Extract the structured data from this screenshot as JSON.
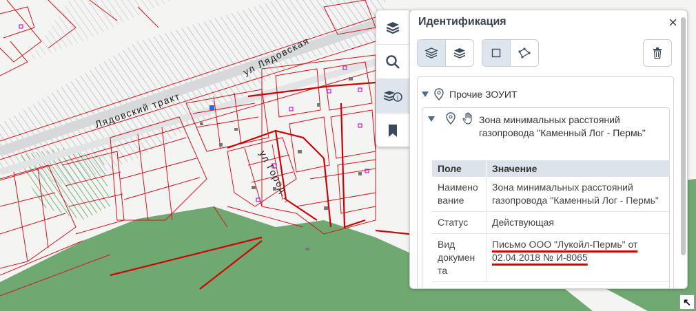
{
  "map": {
    "street_labels": [
      "Лядовский тракт",
      "ул Лядовская",
      "ул Город..."
    ],
    "colors": {
      "background": "#f4f4f2",
      "hatch": "#9ea6b5",
      "parcel": "#d3131b",
      "forest": "#70a872",
      "road": "#d6d8d9"
    }
  },
  "toolbar": {
    "tools": [
      {
        "name": "layers-icon",
        "active": false
      },
      {
        "name": "search-icon",
        "active": false
      },
      {
        "name": "identify-icon",
        "active": true
      },
      {
        "name": "bookmark-icon",
        "active": false
      }
    ]
  },
  "panel": {
    "title": "Идентификация",
    "group": {
      "label": "Прочие ЗОУИТ",
      "item": {
        "title": "Зона минимальных расстояний газопровода \"Каменный Лог - Пермь\"",
        "table": {
          "headers": [
            "Поле",
            "Значение"
          ],
          "rows": [
            {
              "field": "Наимено вание",
              "value": "Зона минимальных расстояний газопровода \"Каменный Лог - Пермь\""
            },
            {
              "field": "Статус",
              "value": "Действующая"
            },
            {
              "field": "Вид докумен та",
              "value_line1": "Письмо ООО \"Лукойл-Пермь\" от",
              "value_line2": "02.04.2018 № И-8065",
              "highlight": "#d40000"
            }
          ]
        }
      }
    }
  }
}
